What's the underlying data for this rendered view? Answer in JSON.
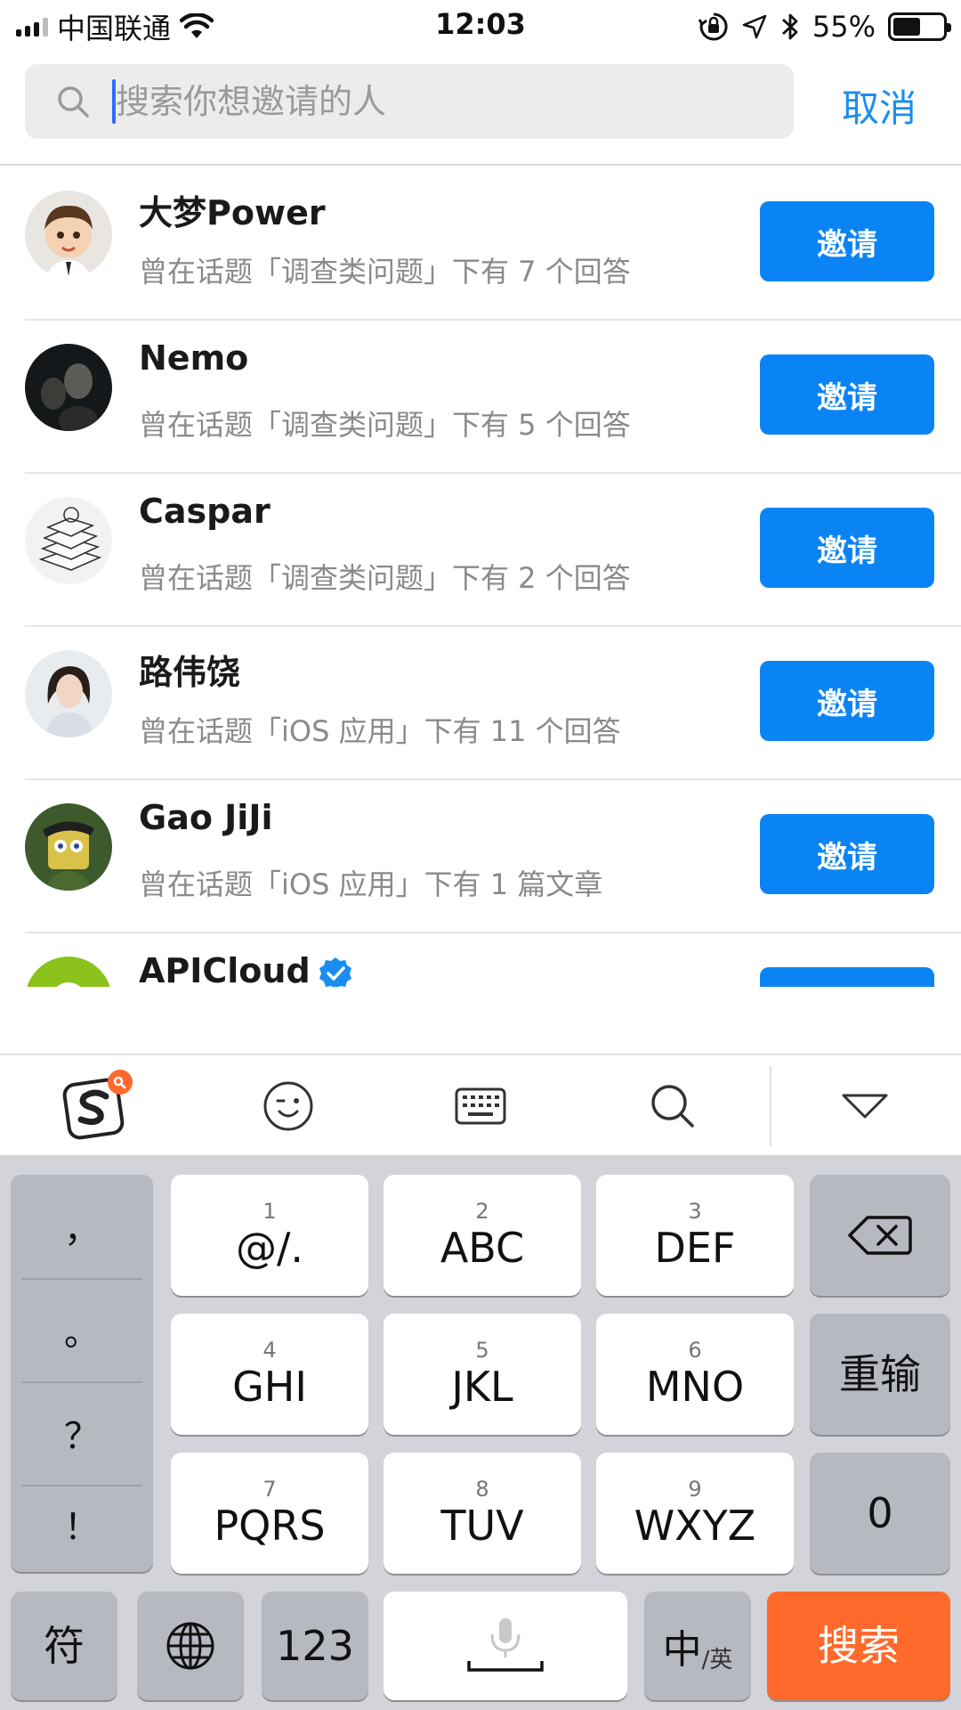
{
  "status_bar": {
    "carrier": "中国联通",
    "time": "12:03",
    "battery_percent": "55%",
    "battery_level": 0.55
  },
  "search": {
    "placeholder": "搜索你想邀请的人",
    "value": "",
    "cancel_label": "取消"
  },
  "users": [
    {
      "name": "大梦Power",
      "subtitle": "曾在话题「调查类问题」下有 7 个回答",
      "invite_label": "邀请",
      "verified": false
    },
    {
      "name": "Nemo",
      "subtitle": "曾在话题「调查类问题」下有 5 个回答",
      "invite_label": "邀请",
      "verified": false
    },
    {
      "name": "Caspar",
      "subtitle": "曾在话题「调查类问题」下有 2 个回答",
      "invite_label": "邀请",
      "verified": false
    },
    {
      "name": "路伟饶",
      "subtitle": "曾在话题「iOS 应用」下有 11 个回答",
      "invite_label": "邀请",
      "verified": false
    },
    {
      "name": "Gao JiJi",
      "subtitle": "曾在话题「iOS 应用」下有 1 篇文章",
      "invite_label": "邀请",
      "verified": false
    },
    {
      "name": "APICloud",
      "subtitle": "",
      "invite_label": "邀请",
      "verified": true
    }
  ],
  "keyboard_toolbar": {
    "icons": [
      "sogou-logo-icon",
      "emoji-icon",
      "keyboard-icon",
      "search-icon",
      "collapse-keyboard-icon"
    ]
  },
  "keyboard": {
    "punctuation": [
      "，",
      "。",
      "？",
      "！"
    ],
    "keys": [
      {
        "num": "1",
        "letters": "@/."
      },
      {
        "num": "2",
        "letters": "ABC"
      },
      {
        "num": "3",
        "letters": "DEF"
      },
      {
        "num": "4",
        "letters": "GHI"
      },
      {
        "num": "5",
        "letters": "JKL"
      },
      {
        "num": "6",
        "letters": "MNO"
      },
      {
        "num": "7",
        "letters": "PQRS"
      },
      {
        "num": "8",
        "letters": "TUV"
      },
      {
        "num": "9",
        "letters": "WXYZ"
      }
    ],
    "reinput_label": "重输",
    "zero_label": "0",
    "symbol_label": "符",
    "num_label": "123",
    "lang_main": "中",
    "lang_sub": "/英",
    "search_label": "搜索"
  },
  "colors": {
    "accent": "#0a84f5",
    "cancel": "#1a8ef0",
    "search_key": "#ff6a2c"
  }
}
